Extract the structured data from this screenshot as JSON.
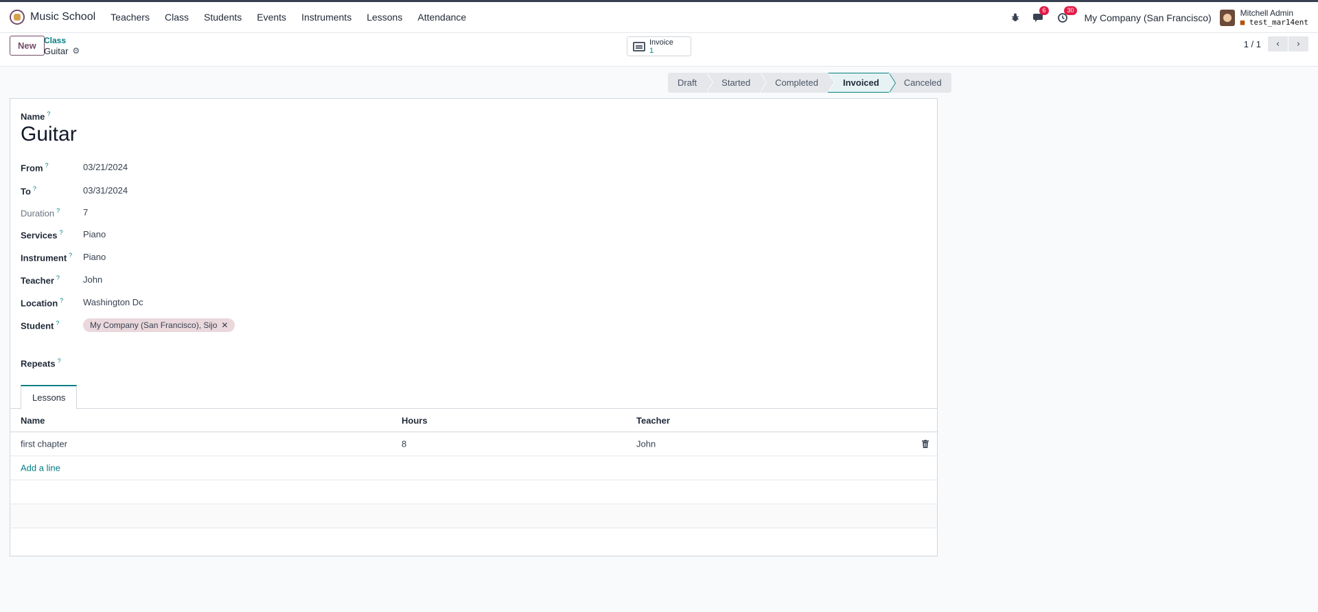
{
  "navbar": {
    "app_name": "Music School",
    "menu": [
      "Teachers",
      "Class",
      "Students",
      "Events",
      "Instruments",
      "Lessons",
      "Attendance"
    ],
    "chat_count": "6",
    "activity_count": "30",
    "company": "My Company (San Francisco)",
    "user_name": "Mitchell Admin",
    "db_name": "test_mar14ent"
  },
  "control": {
    "new_label": "New",
    "breadcrumb_parent": "Class",
    "breadcrumb_current": "Guitar",
    "smart_label": "Invoice",
    "smart_value": "1",
    "pager": "1 / 1"
  },
  "stages": [
    "Draft",
    "Started",
    "Completed",
    "Invoiced",
    "Canceled"
  ],
  "active_stage": "Invoiced",
  "form": {
    "name_label": "Name",
    "name": "Guitar",
    "from_label": "From",
    "from": "03/21/2024",
    "to_label": "To",
    "to": "03/31/2024",
    "duration_label": "Duration",
    "duration": "7",
    "services_label": "Services",
    "services": "Piano",
    "instrument_label": "Instrument",
    "instrument": "Piano",
    "teacher_label": "Teacher",
    "teacher": "John",
    "location_label": "Location",
    "location": "Washington Dc",
    "student_label": "Student",
    "student_tag": "My Company (San Francisco), Sijo",
    "repeats_label": "Repeats",
    "help_mark": "?"
  },
  "tabs": {
    "lessons": "Lessons"
  },
  "lessons": {
    "headers": [
      "Name",
      "Hours",
      "Teacher"
    ],
    "rows": [
      {
        "name": "first chapter",
        "hours": "8",
        "teacher": "John"
      }
    ],
    "add_line": "Add a line"
  },
  "colors": {
    "brand": "#714b67",
    "accent": "#017e84",
    "badge": "#e11d48"
  }
}
